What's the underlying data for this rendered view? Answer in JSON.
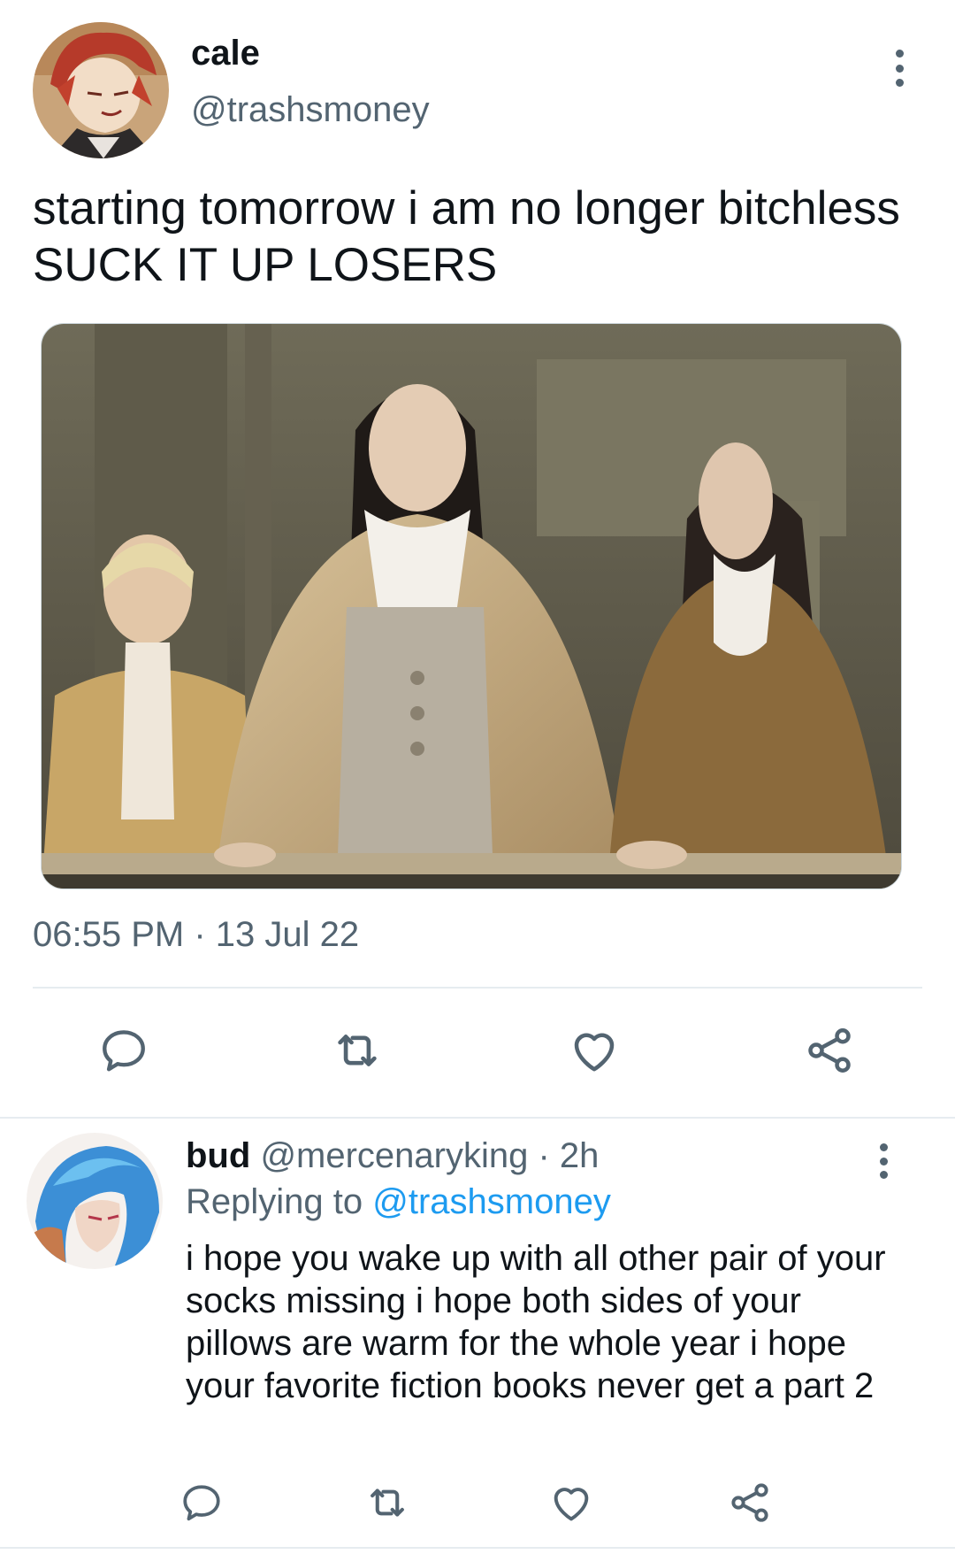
{
  "tweet": {
    "author_name": "cale",
    "author_handle": "@trashsmoney",
    "text": "starting tomorrow i am no longer bitchless SUCK IT UP LOSERS",
    "timestamp": "06:55 PM · 13 Jul 22",
    "icons": {
      "more": "more-vertical-icon",
      "reply": "reply-icon",
      "retweet": "retweet-icon",
      "like": "heart-icon",
      "share": "share-icon"
    }
  },
  "reply": {
    "author_name": "bud",
    "author_handle": "@mercenaryking",
    "separator": " · ",
    "time": "2h",
    "replying_prefix": "Replying to ",
    "replying_to": "@trashsmoney",
    "text": "i hope you wake up with all other pair of your socks missing i hope both sides of your pillows are warm for the whole year i hope your favorite fiction books never get a part 2"
  },
  "colors": {
    "text_primary": "#0f1419",
    "text_secondary": "#536471",
    "link": "#1d9bf0",
    "divider": "#e6ecf0"
  }
}
